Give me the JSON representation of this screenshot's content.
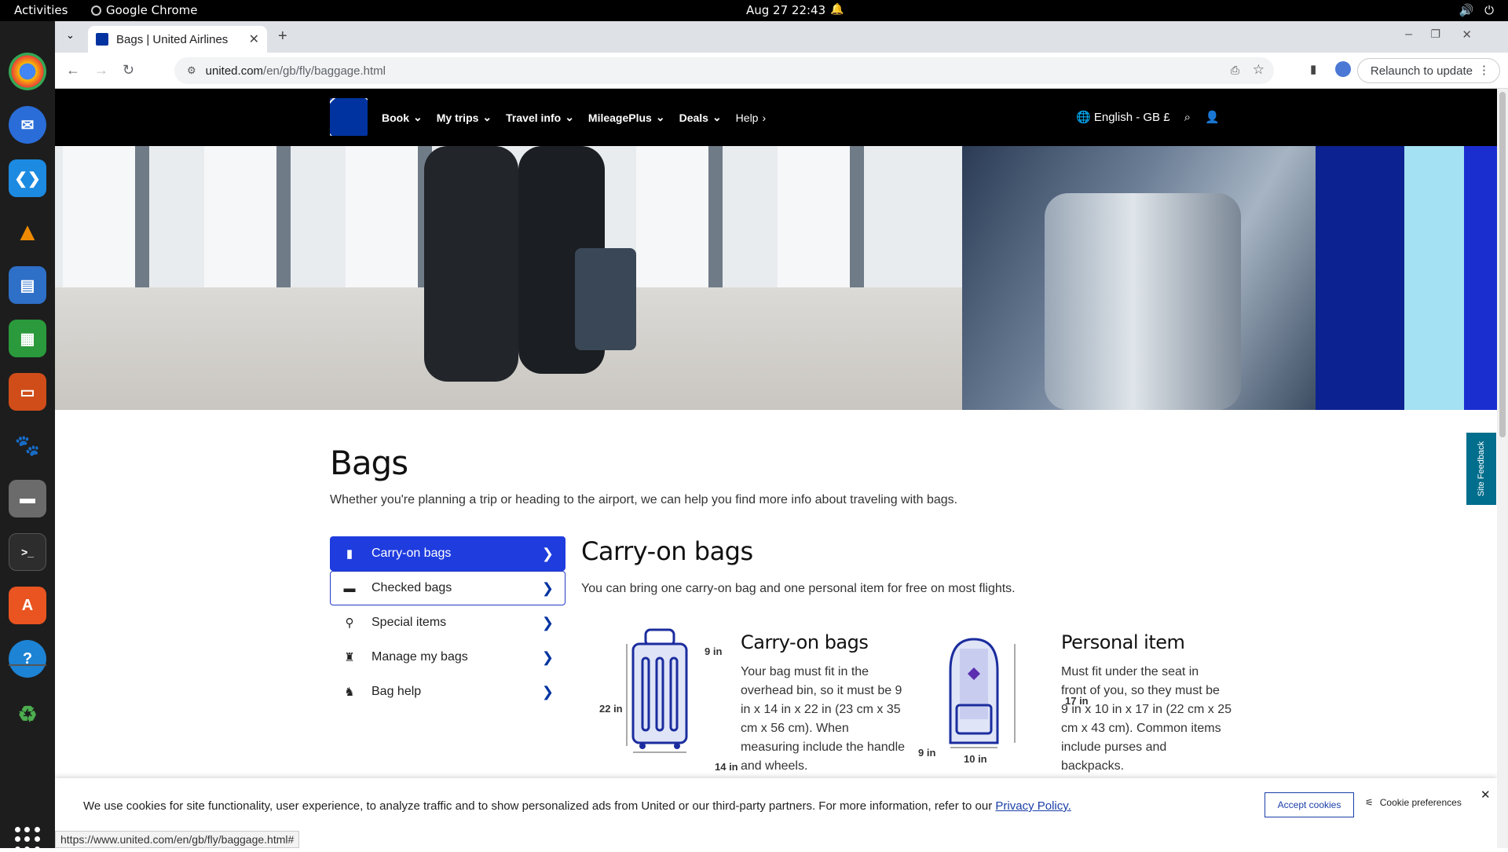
{
  "topbar": {
    "activities": "Activities",
    "app_name": "Google Chrome",
    "clock": "Aug 27  22:43"
  },
  "browser": {
    "tab_title": "Bags | United Airlines",
    "url_host": "united.com",
    "url_path": "/en/gb/fly/baggage.html",
    "relaunch": "Relaunch to update"
  },
  "nav": {
    "items": [
      "Book",
      "My trips",
      "Travel info",
      "MileagePlus",
      "Deals",
      "Help"
    ],
    "language": "English - GB £"
  },
  "feedback": "Site Feedback",
  "page": {
    "title": "Bags",
    "intro": "Whether you're planning a trip or heading to the airport, we can help you find more info about traveling with bags."
  },
  "sidebar": {
    "items": [
      {
        "label": "Carry-on bags",
        "icon": "suitcase-icon"
      },
      {
        "label": "Checked bags",
        "icon": "checked-bag-icon"
      },
      {
        "label": "Special items",
        "icon": "special-items-icon"
      },
      {
        "label": "Manage my bags",
        "icon": "manage-bags-icon"
      },
      {
        "label": "Bag help",
        "icon": "bag-help-icon"
      }
    ]
  },
  "content": {
    "title": "Carry-on bags",
    "sub": "You can bring one carry-on bag and one personal item for free on most flights.",
    "carry": {
      "title": "Carry-on bags",
      "line1": "Your bag must fit in the",
      "line2": "overhead bin, so it must be 9",
      "line3": "in x 14 in x 22 in (23 cm x 35",
      "line4": "cm x 56 cm). When",
      "line5": "measuring include the handle",
      "line6": "and wheels.",
      "h": "22 in",
      "w": "14 in",
      "d": "9 in"
    },
    "personal": {
      "title": "Personal item",
      "line1": "Must fit under the seat in",
      "line2": "front of you, so they must be",
      "line3": "9 in x 10 in x 17 in (22 cm x 25",
      "line4": "cm x 43 cm). Common items",
      "line5": "include purses and",
      "line6": "backpacks.",
      "h": "17 in",
      "w": "10 in",
      "d": "9 in"
    }
  },
  "cookie": {
    "text": "We use cookies for site functionality, user experience, to analyze traffic and to show personalized ads from United or our third-party partners. For more information, refer to our ",
    "link": "Privacy Policy.",
    "accept": "Accept cookies",
    "prefs": "Cookie preferences"
  },
  "status_url": "https://www.united.com/en/gb/fly/baggage.html#",
  "colors": {
    "brand_blue": "#1f3cdf",
    "united_navy": "#0033a0"
  }
}
